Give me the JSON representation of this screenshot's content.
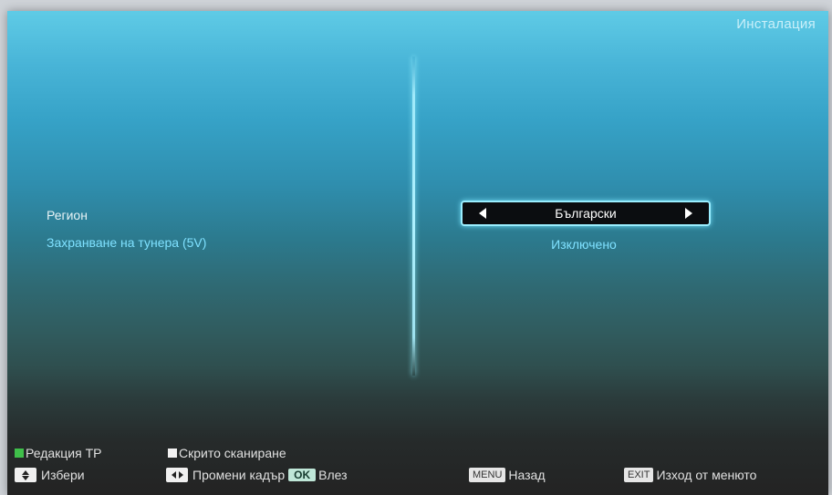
{
  "header": {
    "title": "Инсталация"
  },
  "settings": {
    "rows": [
      {
        "label": "Регион",
        "value": "Български"
      },
      {
        "label": "Захранване на тунера (5V)",
        "value": "Изключено"
      }
    ]
  },
  "footer": {
    "green_label": "Редакция TP",
    "white_label": "Скрито сканиране",
    "select_label": "Избери",
    "change_label": "Промени кадър",
    "ok_key": "OK",
    "enter_label": "Влез",
    "menu_key": "MENU",
    "back_label": "Назад",
    "exit_key": "EXIT",
    "exit_label": "Изход от менюто",
    "colors": {
      "green": "#3fbf4a",
      "white": "#f2f2f2"
    }
  }
}
